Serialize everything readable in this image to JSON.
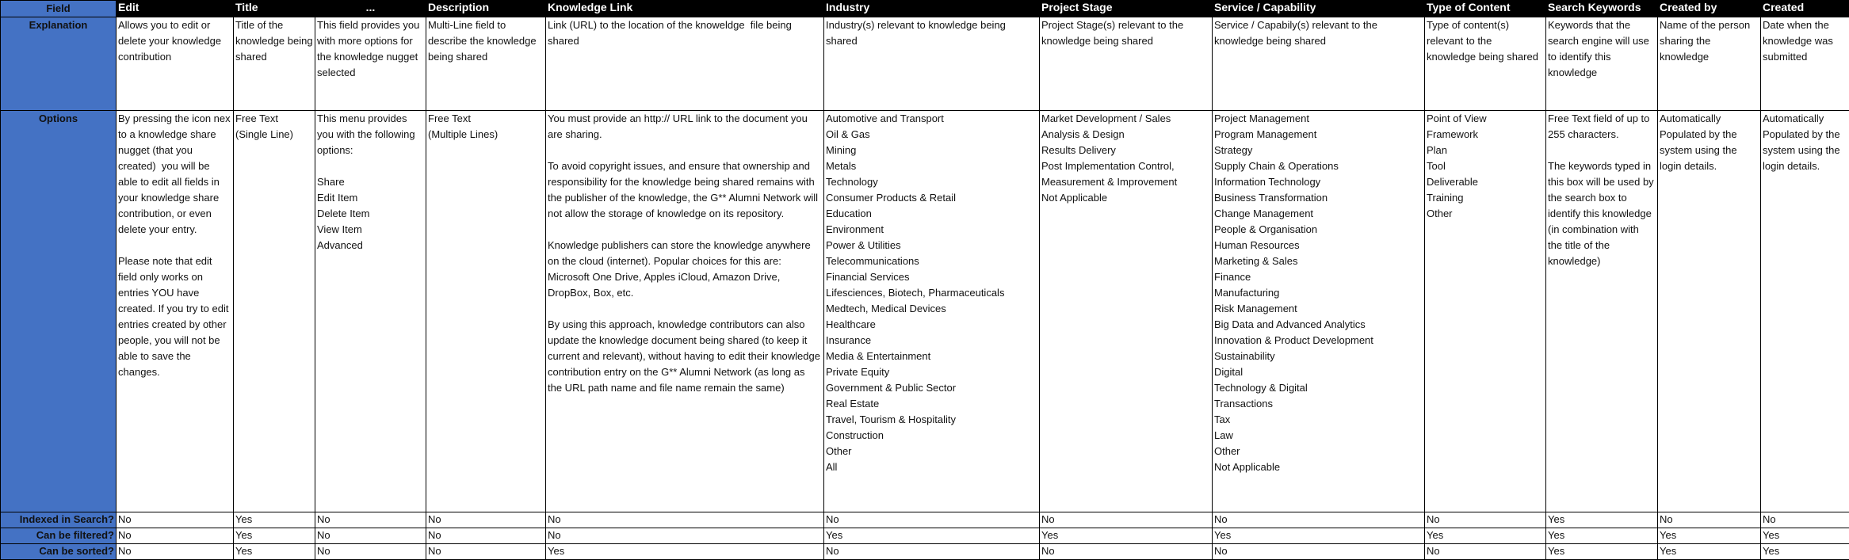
{
  "row_labels": {
    "field": "Field",
    "explanation": "Explanation",
    "options": "Options",
    "indexed": "Indexed in Search?",
    "filtered": "Can be filtered?",
    "sorted": "Can be sorted?"
  },
  "columns": [
    {
      "header": "Edit",
      "explanation": "Allows you to edit or delete your knowledge contribution",
      "options": "By pressing the icon nex to a knowledge share nugget (that you created)  you will be able to edit all fields in your knowledge share contribution, or even delete your entry.\n\nPlease note that edit field only works on entries YOU have created. If you try to edit entries created by other people, you will not be able to save the changes.",
      "indexed": "No",
      "filtered": "No",
      "sorted": "No"
    },
    {
      "header": "Title",
      "explanation": "Title of the knowledge being shared",
      "options": "Free Text\n(Single Line)",
      "indexed": "Yes",
      "filtered": "Yes",
      "sorted": "Yes"
    },
    {
      "header": "...",
      "explanation": "This field provides you with more options for the knowledge nugget selected",
      "options": "This menu provides you with the following options:\n\nShare\nEdit Item\nDelete Item\nView Item\nAdvanced",
      "indexed": "No",
      "filtered": "No",
      "sorted": "No"
    },
    {
      "header": "Description",
      "explanation": "Multi-Line field to describe the knowledge being shared",
      "options": "Free Text\n(Multiple Lines)",
      "indexed": "No",
      "filtered": "No",
      "sorted": "No"
    },
    {
      "header": "Knowledge Link",
      "explanation": "Link (URL) to the location of the knoweldge  file being shared",
      "options": "You must provide an http:// URL link to the document you are sharing.\n\nTo avoid copyright issues, and ensure that ownership and responsibility for the knowledge being shared remains with the publisher of the knowledge, the G** Alumni Network will not allow the storage of knowledge on its repository.\n\nKnowledge publishers can store the knowledge anywhere on the cloud (internet). Popular choices for this are: Microsoft One Drive, Apples iCloud, Amazon Drive, DropBox, Box, etc.\n\nBy using this approach, knowledge contributors can also update the knowledge document being shared (to keep it current and relevant), without having to edit their knowledge contribution entry on the G** Alumni Network (as long as  the URL path name and file name remain the same)",
      "indexed": "No",
      "filtered": "No",
      "sorted": "Yes"
    },
    {
      "header": "Industry",
      "explanation": "Industry(s) relevant to knowledge being shared",
      "options": "Automotive and Transport\nOil & Gas\nMining\nMetals\nTechnology\nConsumer Products & Retail\nEducation\nEnvironment\nPower & Utilities\nTelecommunications\nFinancial Services\nLifesciences, Biotech, Pharmaceuticals\nMedtech, Medical Devices\nHealthcare\nInsurance\nMedia & Entertainment\nPrivate Equity\nGovernment & Public Sector\nReal Estate\nTravel, Tourism & Hospitality\nConstruction\nOther\nAll",
      "indexed": "No",
      "filtered": "Yes",
      "sorted": "No"
    },
    {
      "header": "Project Stage",
      "explanation": "Project Stage(s) relevant to the knowledge being shared",
      "options": "Market Development / Sales\nAnalysis & Design\nResults Delivery\nPost Implementation Control,\nMeasurement & Improvement\nNot Applicable",
      "indexed": "No",
      "filtered": "Yes",
      "sorted": "No"
    },
    {
      "header": "Service / Capability",
      "explanation": "Service / Capabily(s) relevant to the knowledge being shared",
      "options": "Project Management\nProgram Management\nStrategy\nSupply Chain & Operations\nInformation Technology\nBusiness Transformation\nChange Management\nPeople & Organisation\nHuman Resources\nMarketing & Sales\nFinance\nManufacturing\nRisk Management\nBig Data and Advanced Analytics\nInnovation & Product Development\nSustainability\nDigital\nTechnology & Digital\nTransactions\nTax\nLaw\nOther\nNot Applicable",
      "indexed": "No",
      "filtered": "Yes",
      "sorted": "No"
    },
    {
      "header": "Type of Content",
      "explanation": "Type of content(s) relevant to the knowledge being shared",
      "options": "Point of View\nFramework\nPlan\nTool\nDeliverable\nTraining\nOther",
      "indexed": "No",
      "filtered": "Yes",
      "sorted": "No"
    },
    {
      "header": "Search Keywords",
      "explanation": "Keywords that the search engine will use to identify this knowledge",
      "options": "Free Text field of up to 255 characters.\n\nThe keywords typed in this box will be used by the search box to identify this knowledge (in combination with the title of the knowledge)",
      "indexed": "Yes",
      "filtered": "Yes",
      "sorted": "Yes"
    },
    {
      "header": "Created by",
      "explanation": "Name of the person sharing the knowledge",
      "options": "Automatically Populated by the system using the login details.",
      "indexed": "No",
      "filtered": "Yes",
      "sorted": "Yes"
    },
    {
      "header": "Created",
      "explanation": "Date when the knowledge was submitted",
      "options": "Automatically Populated by the system using the login details.",
      "indexed": "No",
      "filtered": "Yes",
      "sorted": "Yes"
    }
  ],
  "colors": {
    "label_column_bg": "#4472C4",
    "header_bg": "#000000",
    "header_text": "#ffffff"
  }
}
